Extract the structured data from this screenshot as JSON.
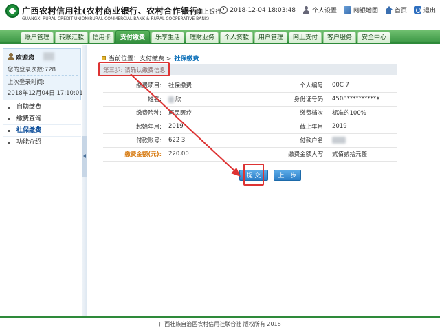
{
  "header": {
    "brand_cn": "广西农村信用社(农村商业银行、农村合作银行)",
    "brand_sub": "个人网上银行",
    "brand_en": "GUANGXI RURAL CREDIT UNION(RURAL COMMERCIAL BANK & RURAL COOPERATIVE BANK)",
    "datetime": "2018-12-04 18:03:48",
    "personal_settings": "个人设置",
    "sitemap": "网银地图",
    "home": "首页",
    "logout": "退出"
  },
  "nav": {
    "tabs": [
      {
        "label": "账户管理"
      },
      {
        "label": "转账汇款"
      },
      {
        "label": "信用卡"
      },
      {
        "label": "支付缴费"
      },
      {
        "label": "乐享生活"
      },
      {
        "label": "理财业务"
      },
      {
        "label": "个人贷款"
      },
      {
        "label": "用户管理"
      },
      {
        "label": "网上支付"
      },
      {
        "label": "客户服务"
      },
      {
        "label": "安全中心"
      }
    ],
    "active_index": 3
  },
  "sidebar": {
    "welcome": "欢迎您",
    "login_count": "您的登录次数:728",
    "last_login_label": "上次登录时间:",
    "last_login_time": "2018年12月04日  17:10:01",
    "items": [
      {
        "label": "自助缴费"
      },
      {
        "label": "缴费查询"
      },
      {
        "label": "社保缴费"
      },
      {
        "label": "功能介绍"
      }
    ],
    "active_index": 2
  },
  "main": {
    "breadcrumb_prefix": "当前位置：支付缴费 >",
    "breadcrumb_current": "社保缴费",
    "step": "第三步: 请确认缴费信息",
    "rows": [
      {
        "l1": "缴费项目:",
        "v1": "社保缴费",
        "l2": "个人编号:",
        "v2": "00C                    7"
      },
      {
        "l1": "姓名:",
        "v1": "欣",
        "l2": "身份证号码:",
        "v2": "4508**********X"
      },
      {
        "l1": "缴费险种:",
        "v1": "居民医疗",
        "l2": "缴费档次:",
        "v2": "标准的100%"
      },
      {
        "l1": "起始年月:",
        "v1": "2019",
        "l2": "截止年月:",
        "v2": "2019"
      },
      {
        "l1": "付款账号:",
        "v1": "622                               3",
        "l2": "付款户名:",
        "v2": ""
      },
      {
        "l1": "缴费金额(元):",
        "v1": "220.00",
        "l2": "缴费金额大写:",
        "v2": "贰佰贰拾元整"
      }
    ],
    "submit_label": "提 交",
    "prev_label": "上一步"
  },
  "footer": {
    "text": "广西壮族自治区农村信用社联合社  版权所有  2018"
  },
  "colors": {
    "brand_green": "#2e8a3a",
    "annotation_red": "#dd3333",
    "button_blue": "#2d7fc8",
    "amount_orange": "#d77a10"
  }
}
